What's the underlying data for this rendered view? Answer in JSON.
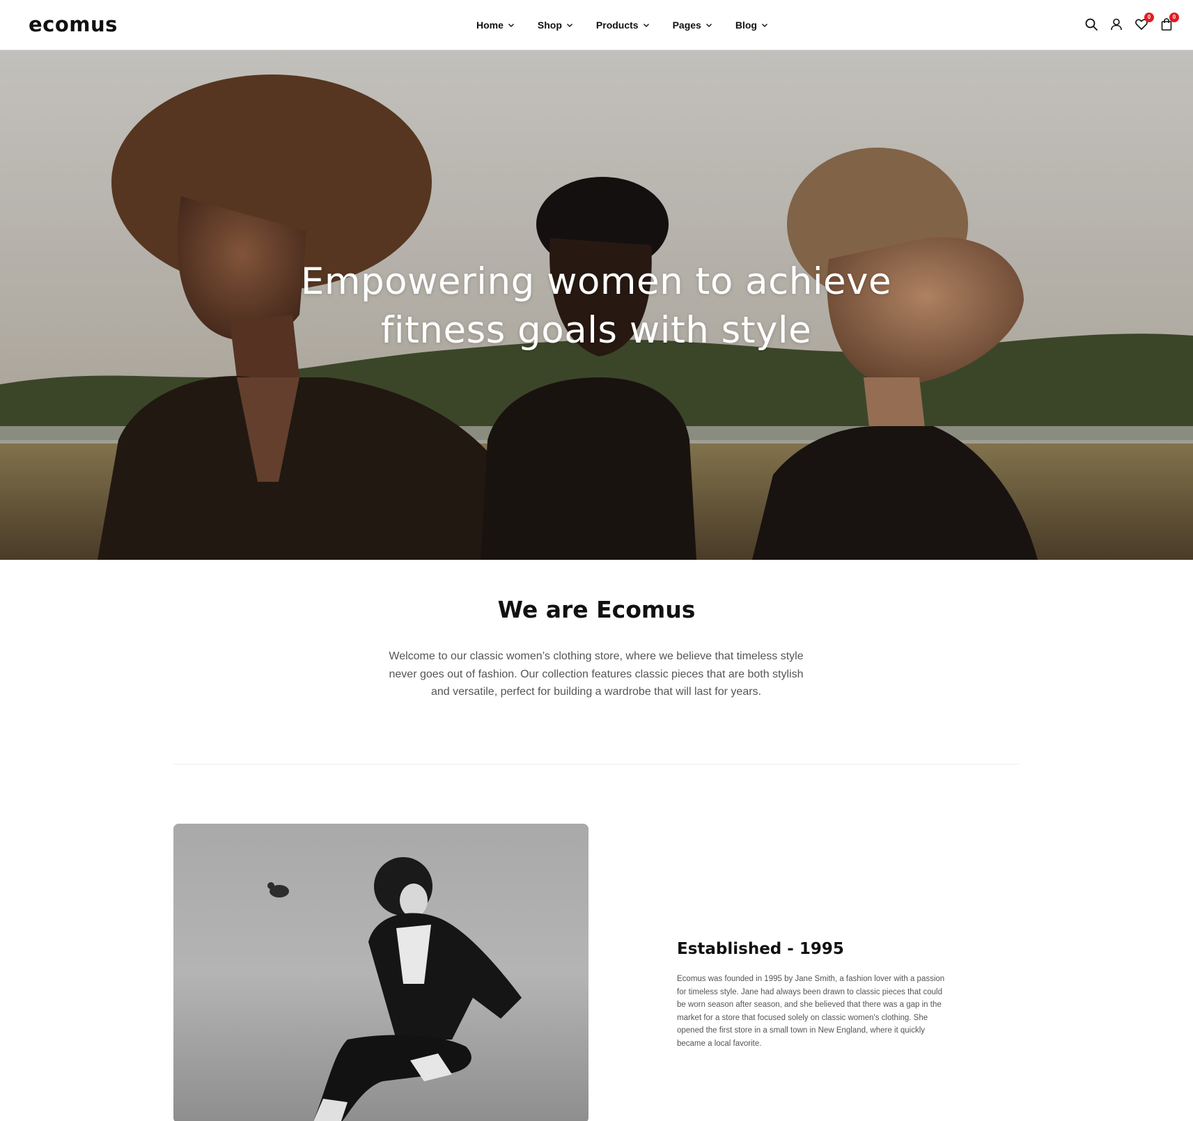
{
  "header": {
    "logo": "ecomus",
    "nav": [
      {
        "label": "Home"
      },
      {
        "label": "Shop"
      },
      {
        "label": "Products"
      },
      {
        "label": "Pages"
      },
      {
        "label": "Blog"
      }
    ],
    "icons": [
      "search-icon",
      "account-icon",
      "wishlist-icon",
      "cart-icon"
    ],
    "wishlist_count": "0",
    "cart_count": "0",
    "badge_color": "#e01d24"
  },
  "hero": {
    "title": "Empowering women to achieve fitness goals with style"
  },
  "about": {
    "title": "We are Ecomus",
    "text": "Welcome to our classic women’s clothing store, where we believe that timeless style never goes out of fashion. Our collection features classic pieces that are both stylish and versatile, perfect for building a wardrobe that will last for years."
  },
  "story": {
    "heading": "Established - 1995",
    "text": "Ecomus was founded in 1995 by Jane Smith, a fashion lover with a passion for timeless style. Jane had always been drawn to classic pieces that could be worn season after season, and she believed that there was a gap in the market for a store that focused solely on classic women's clothing. She opened the first store in a small town in New England, where it quickly became a local favorite."
  }
}
